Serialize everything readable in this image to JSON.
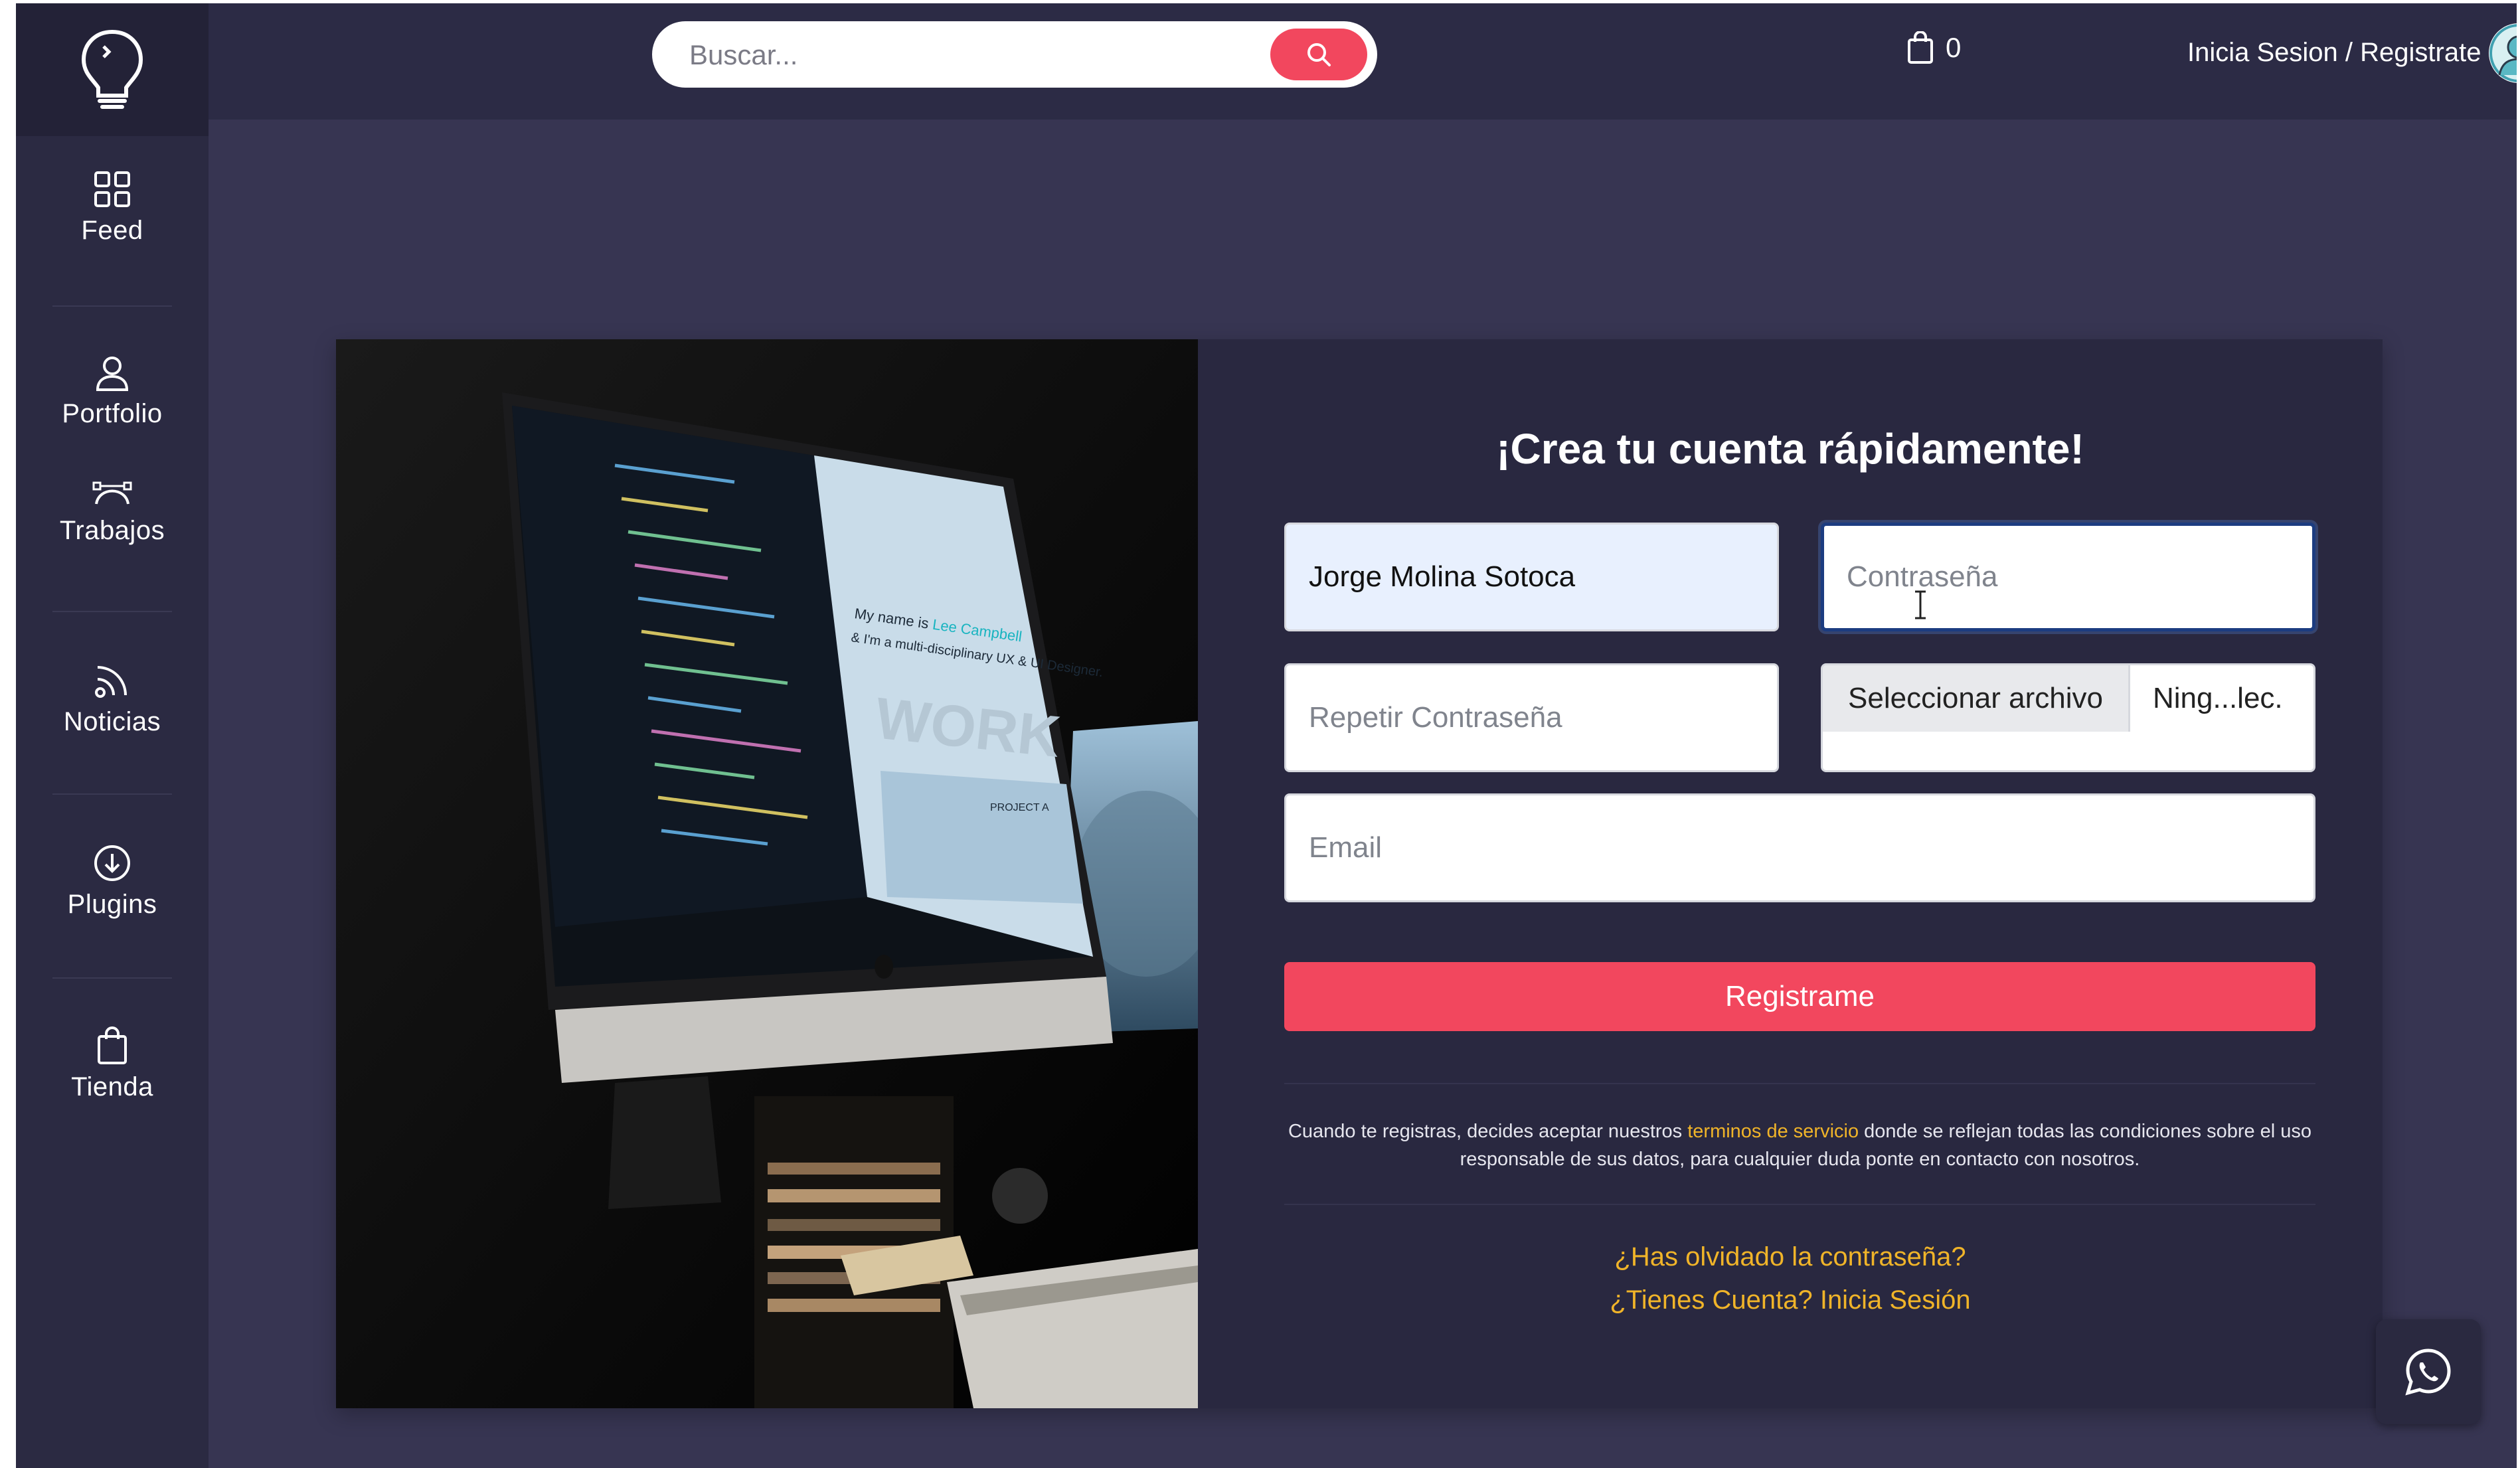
{
  "topbar": {
    "search_placeholder": "Buscar...",
    "cart_count": "0",
    "login_label": "Inicia Sesion / Registrate"
  },
  "sidebar": {
    "items": [
      {
        "label": "Feed",
        "icon": "grid-icon"
      },
      {
        "label": "Portfolio",
        "icon": "user-icon"
      },
      {
        "label": "Trabajos",
        "icon": "bezier-pen-icon"
      },
      {
        "label": "Noticias",
        "icon": "rss-icon"
      },
      {
        "label": "Plugins",
        "icon": "download-circle-icon"
      },
      {
        "label": "Tienda",
        "icon": "shopping-bag-icon"
      }
    ]
  },
  "register": {
    "title": "¡Crea tu cuenta rápidamente!",
    "name_value": "Jorge Molina Sotoca",
    "password_placeholder": "Contraseña",
    "repeat_password_placeholder": "Repetir Contraseña",
    "file_button_label": "Seleccionar archivo",
    "file_status": "Ning...lec.",
    "email_placeholder": "Email",
    "submit_label": "Registrame",
    "terms_before": "Cuando te registras, decides aceptar nuestros ",
    "terms_link": "terminos de servicio",
    "terms_after": " donde se reflejan todas las condiciones sobre el uso responsable de sus datos, para cualquier duda ponte en contacto con nosotros.",
    "forgot_link": "¿Has olvidado la contraseña?",
    "login_link": "¿Tienes Cuenta? Inicia Sesión"
  },
  "photo": {
    "screen_text_line1": "My name is",
    "screen_text_name": "Lee Campbell",
    "screen_text_rest": "& I'm a multi-disciplinary UX & UI Designer.",
    "screen_work": "WORK",
    "screen_project": "PROJECT A"
  },
  "colors": {
    "background": "#373552",
    "sidebar": "#2b2a42",
    "accent": "#f2475e",
    "link": "#f0b429",
    "toggle": "#f5a31a"
  }
}
